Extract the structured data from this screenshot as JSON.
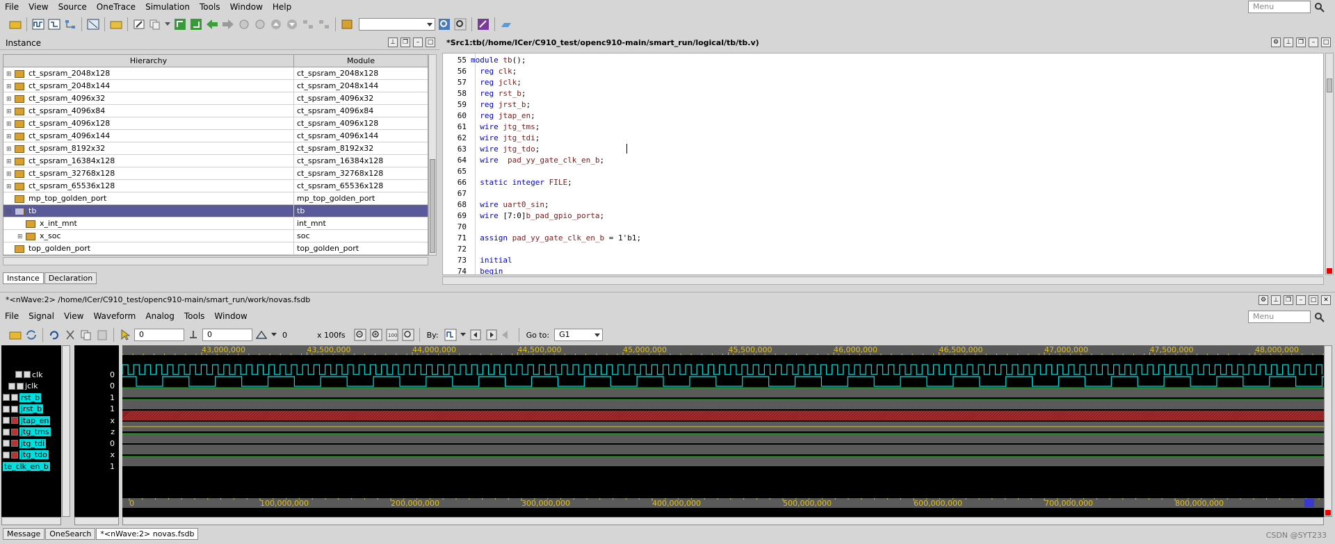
{
  "menu": {
    "items": [
      "File",
      "View",
      "Source",
      "OneTrace",
      "Simulation",
      "Tools",
      "Window",
      "Help"
    ],
    "search_placeholder": "Menu"
  },
  "instance_panel": {
    "title": "Instance",
    "col_hierarchy": "Hierarchy",
    "col_module": "Module",
    "rows": [
      {
        "name": "ct_spsram_2048x128",
        "module": "ct_spsram_2048x128"
      },
      {
        "name": "ct_spsram_2048x144",
        "module": "ct_spsram_2048x144"
      },
      {
        "name": "ct_spsram_4096x32",
        "module": "ct_spsram_4096x32"
      },
      {
        "name": "ct_spsram_4096x84",
        "module": "ct_spsram_4096x84"
      },
      {
        "name": "ct_spsram_4096x128",
        "module": "ct_spsram_4096x128"
      },
      {
        "name": "ct_spsram_4096x144",
        "module": "ct_spsram_4096x144"
      },
      {
        "name": "ct_spsram_8192x32",
        "module": "ct_spsram_8192x32"
      },
      {
        "name": "ct_spsram_16384x128",
        "module": "ct_spsram_16384x128"
      },
      {
        "name": "ct_spsram_32768x128",
        "module": "ct_spsram_32768x128"
      },
      {
        "name": "ct_spsram_65536x128",
        "module": "ct_spsram_65536x128"
      },
      {
        "name": "mp_top_golden_port",
        "module": "mp_top_golden_port"
      },
      {
        "name": "tb",
        "module": "tb"
      },
      {
        "name": "x_int_mnt",
        "module": "int_mnt"
      },
      {
        "name": "x_soc",
        "module": "soc"
      },
      {
        "name": "top_golden_port",
        "module": "top_golden_port"
      }
    ],
    "tabs": [
      "Instance",
      "Declaration"
    ]
  },
  "source_panel": {
    "title": "*Src1:tb(/home/ICer/C910_test/openc910-main/smart_run/logical/tb/tb.v)",
    "lines": [
      {
        "n": "55",
        "t": "module tb();"
      },
      {
        "n": "56",
        "t": "  reg clk;"
      },
      {
        "n": "57",
        "t": "  reg jclk;"
      },
      {
        "n": "58",
        "t": "  reg rst_b;"
      },
      {
        "n": "59",
        "t": "  reg jrst_b;"
      },
      {
        "n": "60",
        "t": "  reg jtap_en;"
      },
      {
        "n": "61",
        "t": "  wire jtg_tms;"
      },
      {
        "n": "62",
        "t": "  wire jtg_tdi;"
      },
      {
        "n": "63",
        "t": "  wire jtg_tdo;"
      },
      {
        "n": "64",
        "t": "  wire  pad_yy_gate_clk_en_b;"
      },
      {
        "n": "65",
        "t": ""
      },
      {
        "n": "66",
        "t": "  static integer FILE;"
      },
      {
        "n": "67",
        "t": ""
      },
      {
        "n": "68",
        "t": "  wire uart0_sin;"
      },
      {
        "n": "69",
        "t": "  wire [7:0]b_pad_gpio_porta;"
      },
      {
        "n": "70",
        "t": ""
      },
      {
        "n": "71",
        "t": "  assign pad_yy_gate_clk_en_b = 1'b1;"
      },
      {
        "n": "72",
        "t": ""
      },
      {
        "n": "73",
        "t": "  initial"
      },
      {
        "n": "74",
        "t": "  begin"
      }
    ]
  },
  "wave_panel": {
    "title": "*<nWave:2> /home/ICer/C910_test/openc910-main/smart_run/work/novas.fsdb",
    "menu": [
      "File",
      "Signal",
      "View",
      "Waveform",
      "Analog",
      "Tools",
      "Window"
    ],
    "search_placeholder": "Menu",
    "cursor_value": "0",
    "marker_value": "0",
    "delta": "0",
    "unit": "x 100fs",
    "by_label": "By:",
    "goto_label": "Go to:",
    "goto_value": "G1",
    "top_ruler": [
      "43,000,000",
      "43,500,000",
      "44,000,000",
      "44,500,000",
      "45,000,000",
      "45,500,000",
      "46,000,000",
      "46,500,000",
      "47,000,000",
      "47,500,000",
      "48,000,000"
    ],
    "bottom_ruler": [
      "0",
      "100,000,000",
      "200,000,000",
      "300,000,000",
      "400,000,000",
      "500,000,000",
      "600,000,000",
      "700,000,000",
      "800,000,000"
    ],
    "signals": [
      {
        "name": "clk",
        "value": "0"
      },
      {
        "name": "jclk",
        "value": "0"
      },
      {
        "name": "rst_b",
        "value": "1"
      },
      {
        "name": "jrst_b",
        "value": "1"
      },
      {
        "name": "jtap_en",
        "value": "x"
      },
      {
        "name": "jtg_tms",
        "value": "z"
      },
      {
        "name": "jtg_tdi",
        "value": "0"
      },
      {
        "name": "jtg_tdo",
        "value": "x"
      },
      {
        "name": "te_clk_en_b",
        "value": "1"
      }
    ]
  },
  "bottom_tabs": [
    "Message",
    "OneSearch",
    "*<nWave:2> novas.fsdb"
  ],
  "watermark": "CSDN @SYT233"
}
